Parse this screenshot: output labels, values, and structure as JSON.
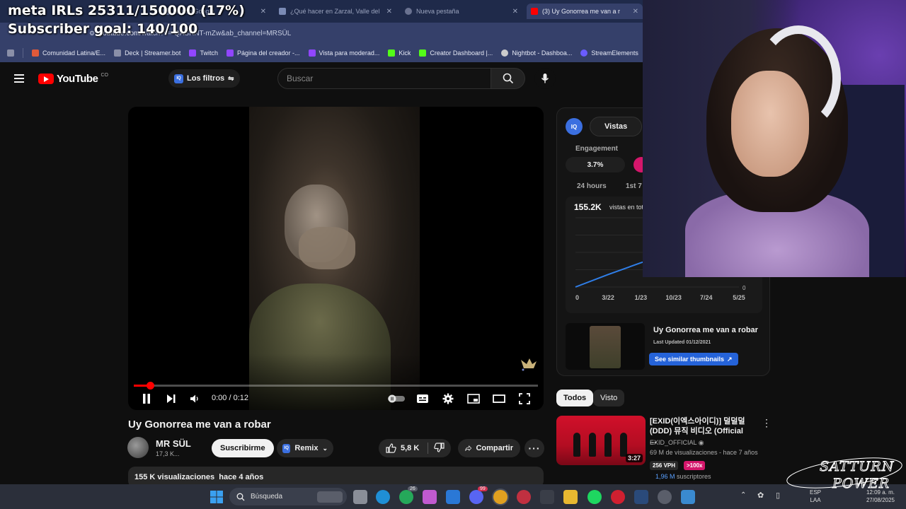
{
  "overlay": {
    "goal_line1": "meta IRLs 25311/150000 (17%)",
    "goal_line2": "Subscriber goal: 140/100"
  },
  "browser": {
    "tabs": [
      {
        "label": "ar con Google",
        "active": false
      },
      {
        "label": "¿Qué hacer en Zarzal, Valle del",
        "active": false
      },
      {
        "label": "Nueva pestaña",
        "active": false
      },
      {
        "label": "(3) Uy Gonorrea me van a r",
        "active": true
      }
    ],
    "url_site": "youtube.com",
    "url_path": "/watch?v=-QASRNT-mZw&ab_channel=MRSÜL",
    "bookmarks": [
      {
        "label": "Comunidad Latina/E...",
        "color": "#e05a3a"
      },
      {
        "label": "Deck | Streamer.bot",
        "color": "#8a8fa8"
      },
      {
        "label": "Twitch",
        "color": "#9146ff"
      },
      {
        "label": "Página del creador -...",
        "color": "#9146ff"
      },
      {
        "label": "Vista para moderad...",
        "color": "#9146ff"
      },
      {
        "label": "Kick",
        "color": "#53fc18"
      },
      {
        "label": "Creator Dashboard |...",
        "color": "#53fc18"
      },
      {
        "label": "Nightbot - Dashboa...",
        "color": "#cccccc"
      },
      {
        "label": "StreamElements",
        "color": "#6a5cff"
      }
    ]
  },
  "youtube": {
    "logo_text": "YouTube",
    "logo_country": "CO",
    "filters_label": "Los filtros",
    "search_placeholder": "Buscar",
    "video": {
      "title": "Uy Gonorrea me van a robar",
      "time": "0:00 / 0:12",
      "progress": 0.04
    },
    "channel": {
      "name": "MR SÜL",
      "subs": "17,3 K..."
    },
    "subscribe_label": "Suscribirme",
    "remix_label": "Remix",
    "likes": "5,8 K",
    "share_label": "Compartir",
    "description": "155 K visualizaciones  hace 4 años"
  },
  "iq_panel": {
    "logo": "IQ",
    "tab_label": "Vistas",
    "engagement_label": "Engagement",
    "engagement_value": "3.7%",
    "range_24h": "24 hours",
    "range_1st": "1st 7 c",
    "views_value": "155.2K",
    "views_label": "vistas en tot",
    "thumb_title": "Uy Gonorrea me van a robar",
    "thumb_updated": "Last Updated 01/12/2021",
    "similar_label": "See similar thumbnails",
    "chart_zero": "0"
  },
  "chart_data": {
    "type": "line",
    "x": [
      "0",
      "3/22",
      "1/23",
      "10/23",
      "7/24",
      "5/25"
    ],
    "xlabel": "",
    "ylabel": "",
    "ylim": [
      0,
      1
    ],
    "series": [
      {
        "values": [
          0.0,
          0.18,
          0.35,
          0.5,
          0.62,
          0.75
        ]
      }
    ]
  },
  "recommend": {
    "chips": [
      "Todos",
      "Visto"
    ],
    "title": "[EXID(이엑스아이디)] 덜덜덜 (DDD) 뮤직 비디오 (Official ...",
    "channel": "EXID_OFFICIAL",
    "meta": "69 M de visualizaciones - hace 7 años",
    "duration": "3:27",
    "vph": "256 VPH",
    "multiplier": ">100x",
    "subs_value": "1,96 M",
    "subs_label": "suscriptores"
  },
  "taskbar": {
    "search_label": "Búsqueda",
    "lang_top": "ESP",
    "lang_bottom": "LAA",
    "clock": "12:09 a. m.",
    "date": "27/08/2025",
    "badge_a": "26",
    "badge_b": "99"
  },
  "watermark": {
    "line1": "SATTURN",
    "line2": "POWER"
  }
}
